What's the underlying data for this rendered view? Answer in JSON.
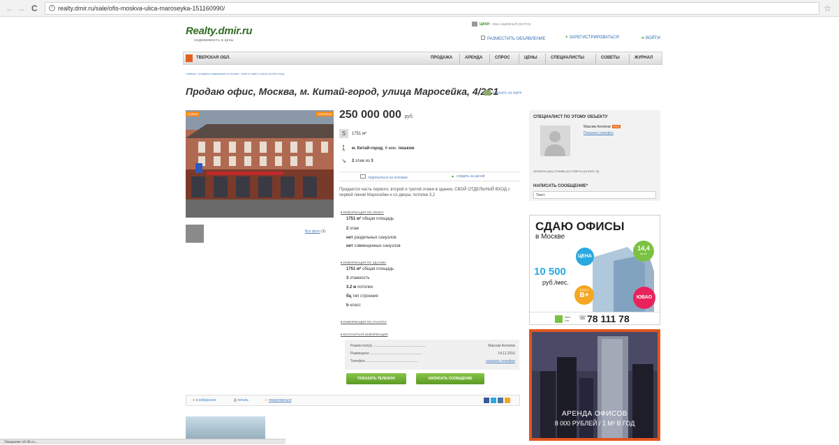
{
  "browser": {
    "back": "←",
    "forward": "→",
    "reload": "C",
    "url": "realty.dmir.ru/sale/ofis-moskva-ulica-maroseyka-151160990/",
    "star": "☆"
  },
  "header": {
    "logo": "Realty.dmir.ru",
    "logo_sub": "недвижимость и цены",
    "cian_brand": "ЦИАН",
    "cian_text": " - ваш надёжный риэлтор",
    "post_ad": "РАЗМЕСТИТЬ ОБЪЯВЛЕНИЕ",
    "register": "ЗАРЕГИСТРИРОВАТЬСЯ",
    "login": "ВОЙТИ"
  },
  "nav": {
    "region": "ТВЕРСКАЯ ОБЛ.",
    "items": [
      "ПРОДАЖА",
      "АРЕНДА",
      "СПРОС",
      "ЦЕНЫ",
      "СПЕЦИАЛИСТЫ",
      "СОВЕТЫ",
      "ЖУРНАЛ"
    ]
  },
  "breadcrumbs": "главная  ›  продажа недвижимости москва  ›  купить офис у метро китай-город",
  "title": "Продаю офис, Москва, м. Китай-город, улица Маросейка, 4/2С1",
  "map_link": "показать на карте",
  "photo": {
    "badge_new": "НОВОЕ",
    "badge_promo": "ПРЕМИУМ",
    "all_photos": "Все фото",
    "count": "(1)"
  },
  "listing": {
    "price": "250 000 000",
    "currency": "руб.",
    "area": "1751",
    "area_unit": "м²",
    "metro": "м. Китай-город",
    "walk": ", 6 мин.",
    "walk_mode": "пешком",
    "floor": "2",
    "floor_of": "этаж из",
    "floor_total": "3",
    "subscribe": "подписаться на похожие",
    "follow_price": "следить за ценой",
    "description": "Продается часть первого, второй и третий этажи в здании, СВОЙ ОТДЕЛЬНЫЙ ВХОД с первой линии Маросейки и со двора, потолки 3,2"
  },
  "office_info": {
    "heading": "ИНФОРМАЦИЯ ПО ОФИСУ",
    "rows": [
      {
        "v": "1751  м²",
        "t": " общая площадь"
      },
      {
        "v": "2",
        "t": " этаж"
      },
      {
        "v": "нет",
        "t": " раздельных санузлов"
      },
      {
        "v": "нет",
        "t": " совмещенных санузлов"
      }
    ]
  },
  "building_info": {
    "heading": "ИНФОРМАЦИЯ ПО ЗДАНИЮ",
    "rows": [
      {
        "v": "1751  м²",
        "t": " общая площадь"
      },
      {
        "v": "3",
        "t": " этажность"
      },
      {
        "v": "3.2  м",
        "t": " потолки"
      },
      {
        "v": "бц",
        "t": " тип строения"
      },
      {
        "v": "b",
        "t": " класс"
      }
    ]
  },
  "plot_info": {
    "heading": "ИНФОРМАЦИЯ ПО УЧАСТКУ"
  },
  "contact_info": {
    "heading": "КОНТАКТНАЯ ИНФОРМАЦИЯ",
    "rows": [
      {
        "k": "Разместил(а)",
        "v": "Максим Антипов"
      },
      {
        "k": "Размещено",
        "v": "14.11.2016"
      },
      {
        "k": "Телефон",
        "v": "показать телефон"
      }
    ]
  },
  "buttons": {
    "show_phone": "ПОКАЗАТЬ ТЕЛЕФОН",
    "write_msg": "НАПИСАТЬ СООБЩЕНИЕ"
  },
  "actions": {
    "favorite": "в избранное",
    "print": "печать",
    "complain": "пожаловаться"
  },
  "agent": {
    "heading": "СПЕЦИАЛИСТ ПО ЭТОМУ ОБЪЕКТУ",
    "name": "Максим Антипов",
    "pro": "PRO",
    "show_phone": "Показать телефон",
    "tabs": "ОБЪЕКТЫ (60)    ОТЗЫВЫ (0)    ОТВЕТЫ (0)    БЛОГ (0)",
    "write": "НАПИСАТЬ СООБЩЕНИЕ*",
    "input_value": "Текст"
  },
  "ad1": {
    "title": "СДАЮ ОФИСЫ",
    "sub": "в Москве",
    "price": "10 500",
    "price_unit": "руб./мес.",
    "bubble_price": "ЦЕНА",
    "bubble_km": "14,4",
    "bubble_km_unit": "км от",
    "bubble_class_l": "КЛАСС",
    "bubble_class": "B+",
    "bubble_area": "ЮВАО",
    "brand": "New Life",
    "phone": "78 111 78"
  },
  "ad2": {
    "line1": "АРЕНДА ОФИСОВ",
    "line2": "8 000 РУБЛЕЙ / 1 М² В ГОД"
  },
  "status": "Ожидание s9.rtb.ru..."
}
